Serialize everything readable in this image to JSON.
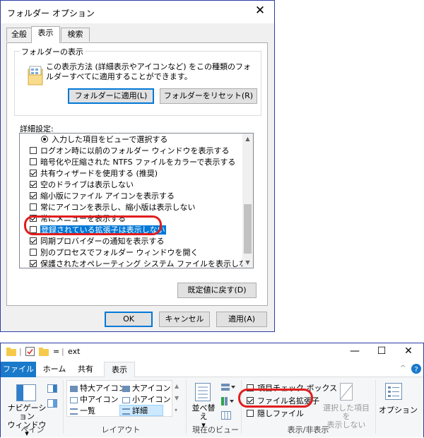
{
  "dialog": {
    "title": "フォルダー オプション",
    "close": "✕",
    "tabs": [
      "全般",
      "表示",
      "検索"
    ],
    "group_title": "フォルダーの表示",
    "group_desc": "この表示方法 (詳細表示やアイコンなど) をこの種類のフォルダーすべてに適用することができます。",
    "apply_button": "フォルダーに適用(L)",
    "reset_button": "フォルダーをリセット(R)",
    "advanced_label": "詳細設定:",
    "items": [
      {
        "label": "入力した項目をビューで選択する",
        "type": "radio",
        "checked": true
      },
      {
        "label": "ログオン時に以前のフォルダー ウィンドウを表示する",
        "type": "checkbox",
        "checked": false
      },
      {
        "label": "暗号化や圧縮された NTFS ファイルをカラーで表示する",
        "type": "checkbox",
        "checked": false
      },
      {
        "label": "共有ウィザードを使用する (推奨)",
        "type": "checkbox",
        "checked": true
      },
      {
        "label": "空のドライブは表示しない",
        "type": "checkbox",
        "checked": true
      },
      {
        "label": "縮小版にファイル アイコンを表示する",
        "type": "checkbox",
        "checked": true
      },
      {
        "label": "常にアイコンを表示し、縮小版は表示しない",
        "type": "checkbox",
        "checked": false
      },
      {
        "label": "常にメニューを表示する",
        "type": "checkbox",
        "checked": true
      },
      {
        "label": "登録されている拡張子は表示しない",
        "type": "checkbox",
        "checked": false,
        "selected": true
      },
      {
        "label": "同期プロバイダーの通知を表示する",
        "type": "checkbox",
        "checked": true
      },
      {
        "label": "別のプロセスでフォルダー ウィンドウを開く",
        "type": "checkbox",
        "checked": false
      },
      {
        "label": "保護されたオペレーティング システム ファイルを表示しない (推奨)",
        "type": "checkbox",
        "checked": true
      }
    ],
    "defaults_button": "既定値に戻す(D)",
    "ok": "OK",
    "cancel": "キャンセル",
    "apply": "適用(A)"
  },
  "explorer": {
    "title": "ext",
    "qa_sep": "|",
    "qa_arrow": "=",
    "minimize": "—",
    "maximize": "☐",
    "close": "✕",
    "tabs": {
      "file": "ファイル",
      "home": "ホーム",
      "share": "共有",
      "view": "表示"
    },
    "nav_pane": "ナビゲーション\nウィンドウ ▾",
    "pane_group": "ペイン",
    "layout": [
      "特大アイコン",
      "大アイコン",
      "中アイコン",
      "小アイコン",
      "一覧",
      "詳細"
    ],
    "layout_group": "レイアウト",
    "sort": "並べ替え\n▾",
    "current_view_group": "現在のビュー",
    "checks": [
      {
        "label": "項目チェック ボックス",
        "checked": false
      },
      {
        "label": "ファイル名拡張子",
        "checked": true
      },
      {
        "label": "隠しファイル",
        "checked": false
      }
    ],
    "hide_selected": "選択した項目を\n表示しない",
    "options": "オプション",
    "show_hide_group": "表示/非表示",
    "colors": {
      "file_tab": "#1979ca",
      "help": "#1979ca"
    }
  }
}
